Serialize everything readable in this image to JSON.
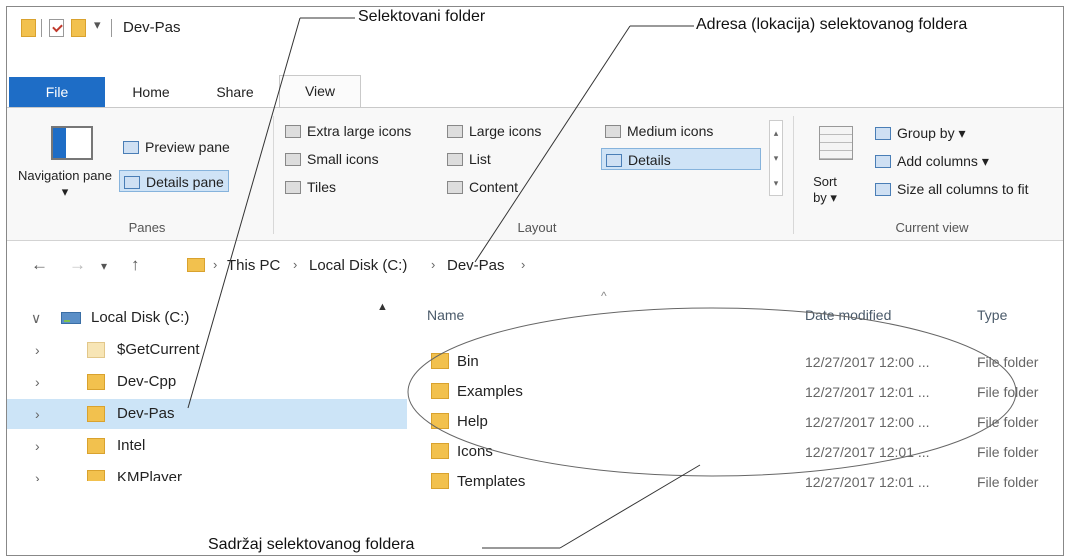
{
  "window": {
    "title": "Dev-Pas"
  },
  "ribbon_tabs": [
    "File",
    "Home",
    "Share",
    "View"
  ],
  "ribbon": {
    "panes": {
      "navigation_pane": "Navigation pane ▾",
      "preview_pane": "Preview pane",
      "details_pane": "Details pane",
      "group_label": "Panes"
    },
    "layout": {
      "extra_large_icons": "Extra large icons",
      "large_icons": "Large icons",
      "medium_icons": "Medium icons",
      "small_icons": "Small icons",
      "list": "List",
      "details": "Details",
      "tiles": "Tiles",
      "content": "Content",
      "group_label": "Layout",
      "selected": "Details"
    },
    "current_view": {
      "sort_by": "Sort by ▾",
      "group_by": "Group by ▾",
      "add_columns": "Add columns ▾",
      "size_columns": "Size all columns to fit",
      "group_label": "Current view"
    }
  },
  "address": {
    "crumbs": [
      "This PC",
      "Local Disk (C:)",
      "Dev-Pas"
    ]
  },
  "tree": {
    "root": "Local Disk (C:)",
    "items": [
      "$GetCurrent",
      "Dev-Cpp",
      "Dev-Pas",
      "Intel",
      "KMPlayer"
    ],
    "selected": "Dev-Pas"
  },
  "file_list": {
    "columns": [
      "Name",
      "Date modified",
      "Type"
    ],
    "rows": [
      {
        "name": "Bin",
        "date": "12/27/2017 12:00 ...",
        "type": "File folder"
      },
      {
        "name": "Examples",
        "date": "12/27/2017 12:01 ...",
        "type": "File folder"
      },
      {
        "name": "Help",
        "date": "12/27/2017 12:00 ...",
        "type": "File folder"
      },
      {
        "name": "Icons",
        "date": "12/27/2017 12:01 ...",
        "type": "File folder"
      },
      {
        "name": "Templates",
        "date": "12/27/2017 12:01 ...",
        "type": "File folder"
      }
    ]
  },
  "annotations": {
    "selected_folder": "Selektovani folder",
    "address_label": "Adresa (lokacija) selektovanog foldera",
    "contents_label": "Sadržaj selektovanog foldera"
  },
  "colors": {
    "file_tab": "#1e6dc6",
    "selection": "#cce4f7",
    "folder": "#f2c14e"
  }
}
